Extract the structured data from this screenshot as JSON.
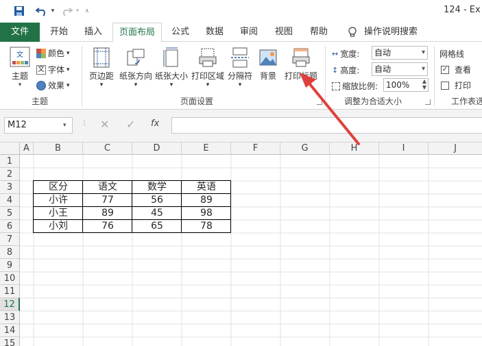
{
  "titlebar": {
    "title": "124 - Ex",
    "save_icon": "save-icon",
    "undo_icon": "undo-icon",
    "redo_icon": "redo-icon"
  },
  "tabs": [
    "文件",
    "开始",
    "插入",
    "页面布局",
    "公式",
    "数据",
    "审阅",
    "视图",
    "帮助",
    "操作说明搜索"
  ],
  "ribbon": {
    "theme_group": {
      "label": "主题",
      "theme_button": "主题",
      "colors": "颜色",
      "fonts": "字体",
      "effects": "效果"
    },
    "page_setup_group": {
      "label": "页面设置",
      "buttons": [
        "页边距",
        "纸张方向",
        "纸张大小",
        "打印区域",
        "分隔符",
        "背景",
        "打印标题"
      ]
    },
    "scale_group": {
      "label": "调整为合适大小",
      "width_label": "宽度:",
      "width_value": "自动",
      "height_label": "高度:",
      "height_value": "自动",
      "scale_label": "缩放比例:",
      "scale_value": "100%"
    },
    "sheet_options_group": {
      "label": "工作表选",
      "gridlines": "网格线",
      "view": "查看",
      "print": "打印",
      "view_checked": true,
      "print_checked": false
    }
  },
  "formula_bar": {
    "name_box": "M12",
    "fx": "fx",
    "formula": ""
  },
  "columns": [
    "A",
    "B",
    "C",
    "D",
    "E",
    "F",
    "G",
    "H",
    "I",
    "J"
  ],
  "rows": [
    "1",
    "2",
    "3",
    "4",
    "5",
    "6",
    "7",
    "8",
    "9",
    "10",
    "11",
    "12",
    "13",
    "14",
    "15"
  ],
  "selected_row": "12",
  "table": {
    "headers": [
      "区分",
      "语文",
      "数学",
      "英语"
    ],
    "rows": [
      [
        "小许",
        "77",
        "56",
        "89"
      ],
      [
        "小王",
        "89",
        "45",
        "98"
      ],
      [
        "小刘",
        "76",
        "65",
        "78"
      ]
    ]
  },
  "colors": {
    "accent": "#217346",
    "arrow": "#e0403b"
  }
}
